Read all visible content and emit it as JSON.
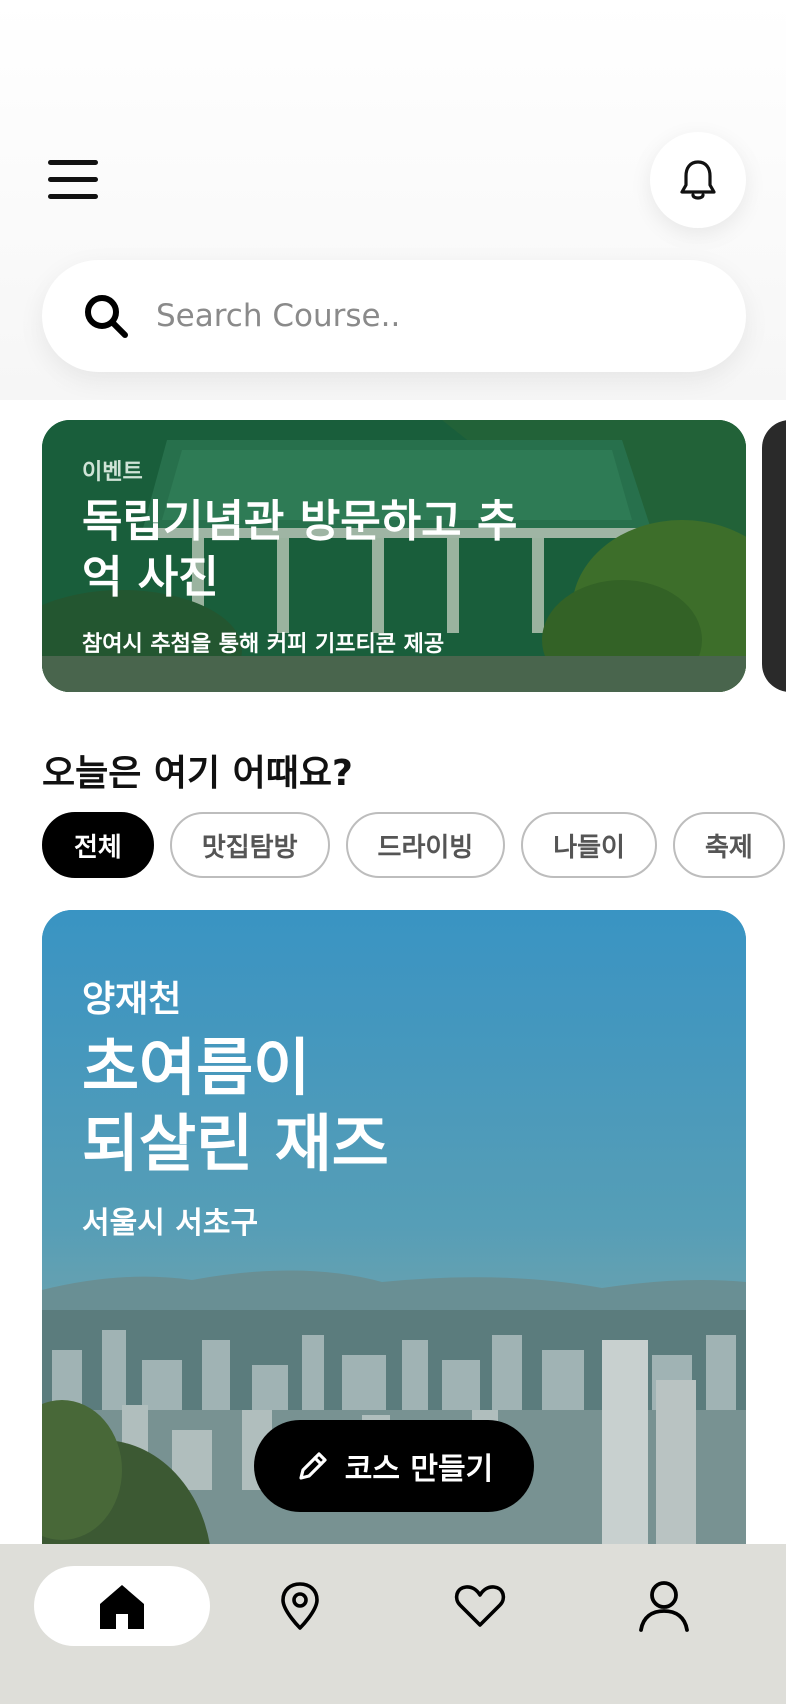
{
  "search": {
    "placeholder": "Search Course.."
  },
  "event_banner": {
    "tag": "이벤트",
    "title": "독립기념관 방문하고 추억 사진",
    "subtitle": "참여시 추첨을 통해 커피 기프티콘 제공"
  },
  "section": {
    "title": "오늘은 여기 어때요?"
  },
  "chips": [
    {
      "label": "전체",
      "selected": true
    },
    {
      "label": "맛집탐방",
      "selected": false
    },
    {
      "label": "드라이빙",
      "selected": false
    },
    {
      "label": "나들이",
      "selected": false
    },
    {
      "label": "축제",
      "selected": false
    }
  ],
  "course_card": {
    "area": "양재천",
    "title_line1": "초여름이",
    "title_line2": "되살린 재즈",
    "location": "서울시 서초구"
  },
  "create_button": {
    "label": "코스 만들기"
  },
  "bottom_nav": {
    "items": [
      {
        "icon": "home-icon",
        "active": true
      },
      {
        "icon": "map-pin-icon",
        "active": false
      },
      {
        "icon": "heart-icon",
        "active": false
      },
      {
        "icon": "user-icon",
        "active": false
      }
    ]
  },
  "colors": {
    "accent": "#000000",
    "event_banner": "#1f6e46",
    "course_sky": "#3f9ac6",
    "nav_background": "#deded9"
  }
}
